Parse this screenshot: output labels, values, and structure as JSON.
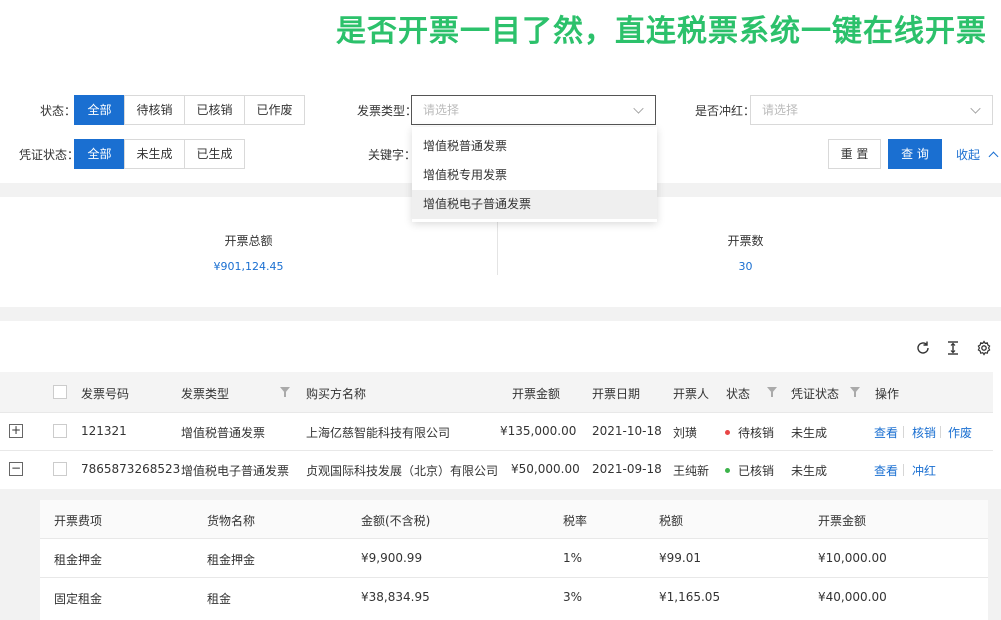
{
  "banner": {
    "text": "是否开票一目了然，直连税票系统一键在线开票",
    "color": "#2cc16b"
  },
  "filters": {
    "status_label": "状态：",
    "status_options": [
      "全部",
      "待核销",
      "已核销",
      "已作废"
    ],
    "status_selected": "全部",
    "invoice_type_label": "发票类型：",
    "invoice_type_placeholder": "请选择",
    "invoice_type_options": [
      "增值税普通发票",
      "增值税专用发票",
      "增值税电子普通发票"
    ],
    "invoice_type_hover": "增值税电子普通发票",
    "reversed_label": "是否冲红：",
    "reversed_placeholder": "请选择",
    "voucher_label": "凭证状态：",
    "voucher_options": [
      "全部",
      "未生成",
      "已生成"
    ],
    "voucher_selected": "全部",
    "keyword_label": "关键字："
  },
  "actions": {
    "reset": "重 置",
    "query": "查 询",
    "collapse": "收起",
    "collapse_icon": "chevron-up-icon"
  },
  "stats": {
    "total_amount_label": "开票总额",
    "total_amount_value": "¥901,124.45",
    "count_label": "开票数",
    "count_value": "30"
  },
  "toolbar": {
    "icons": [
      "refresh-icon",
      "column-height-icon",
      "settings-icon"
    ]
  },
  "table": {
    "columns": [
      "发票号码",
      "发票类型",
      "购买方名称",
      "开票金额",
      "开票日期",
      "开票人",
      "状态",
      "凭证状态",
      "操作"
    ],
    "rows": [
      {
        "expander": "+",
        "invoice_no": "121321",
        "invoice_type": "增值税普通发票",
        "buyer": "上海亿慈智能科技有限公司",
        "amount": "¥135,000.00",
        "date": "2021-10-18",
        "issuer": "刘璜",
        "status": "待核销",
        "status_color": "#e84545",
        "voucher": "未生成",
        "ops": [
          "查看",
          "核销",
          "作废"
        ]
      },
      {
        "expander": "−",
        "invoice_no": "7865873268523",
        "invoice_type": "增值税电子普通发票",
        "buyer": "贞观国际科技发展（北京）有限公司",
        "amount": "¥50,000.00",
        "date": "2021-09-18",
        "issuer": "王纯新",
        "status": "已核销",
        "status_color": "#3cb34a",
        "voucher": "未生成",
        "ops": [
          "查看",
          "冲红"
        ]
      }
    ]
  },
  "subtable": {
    "columns": [
      "开票费项",
      "货物名称",
      "金额(不含税)",
      "税率",
      "税额",
      "开票金额"
    ],
    "rows": [
      [
        "租金押金",
        "租金押金",
        "¥9,900.99",
        "1%",
        "¥99.01",
        "¥10,000.00"
      ],
      [
        "固定租金",
        "租金",
        "¥38,834.95",
        "3%",
        "¥1,165.05",
        "¥40,000.00"
      ]
    ]
  },
  "colors": {
    "primary": "#1a6fd1",
    "accent_green": "#2cc16b"
  }
}
